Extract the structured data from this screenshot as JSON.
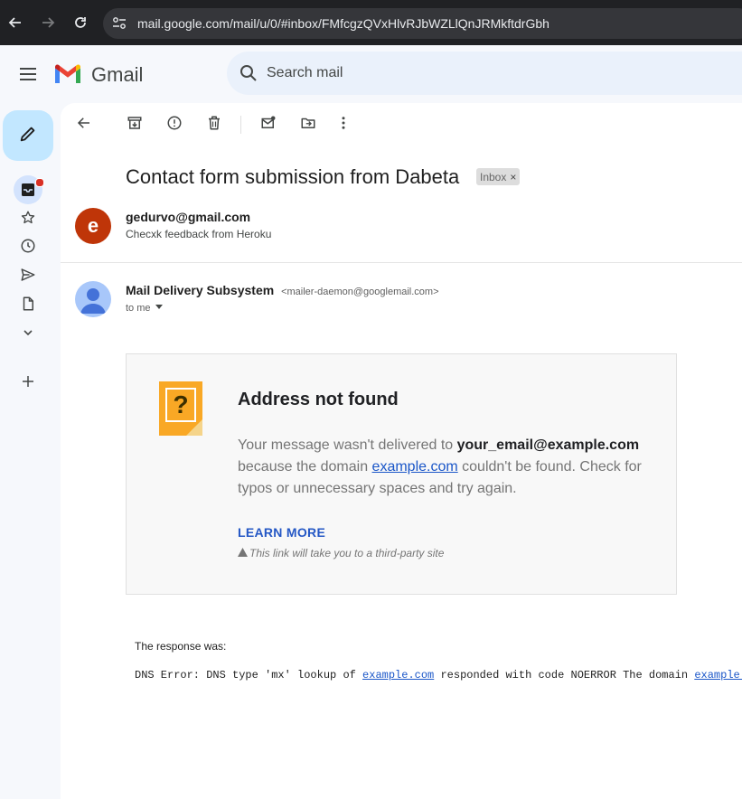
{
  "browser": {
    "url": "mail.google.com/mail/u/0/#inbox/FMfcgzQVxHlvRJbWZLlQnJRMkftdrGbh"
  },
  "header": {
    "brand": "Gmail",
    "search_placeholder": "Search mail"
  },
  "email": {
    "subject": "Contact form submission from Dabeta",
    "label_chip": "Inbox",
    "label_chip_close": "×",
    "first_message": {
      "avatar_letter": "e",
      "sender": "gedurvo@gmail.com",
      "snippet": "Checxk feedback from Heroku"
    },
    "second_message": {
      "sender_name": "Mail Delivery Subsystem",
      "sender_email": "<mailer-daemon@googlemail.com>",
      "to": "to me"
    }
  },
  "bounce_card": {
    "title": "Address not found",
    "body_pre": "Your message wasn't delivered to ",
    "address": "your_email@example.com",
    "body_mid": " because the domain ",
    "domain_link": "example.com",
    "body_post": " couldn't be found. Check for typos or unnecessary spaces and try again.",
    "learn_more": "LEARN MORE",
    "third_party_note": "This link will take you to a third-party site"
  },
  "response": {
    "label": "The response was:",
    "dns_pre": "DNS Error: DNS type 'mx' lookup of ",
    "dns_link1": "example.com",
    "dns_mid": " responded with code NOERROR The domain ",
    "dns_link2": "example.com"
  },
  "colors": {
    "compose_bg": "#c2e7ff",
    "avatar_sender": "#bf3508",
    "link": "#1a56c8",
    "unread_dot": "#d93025"
  }
}
